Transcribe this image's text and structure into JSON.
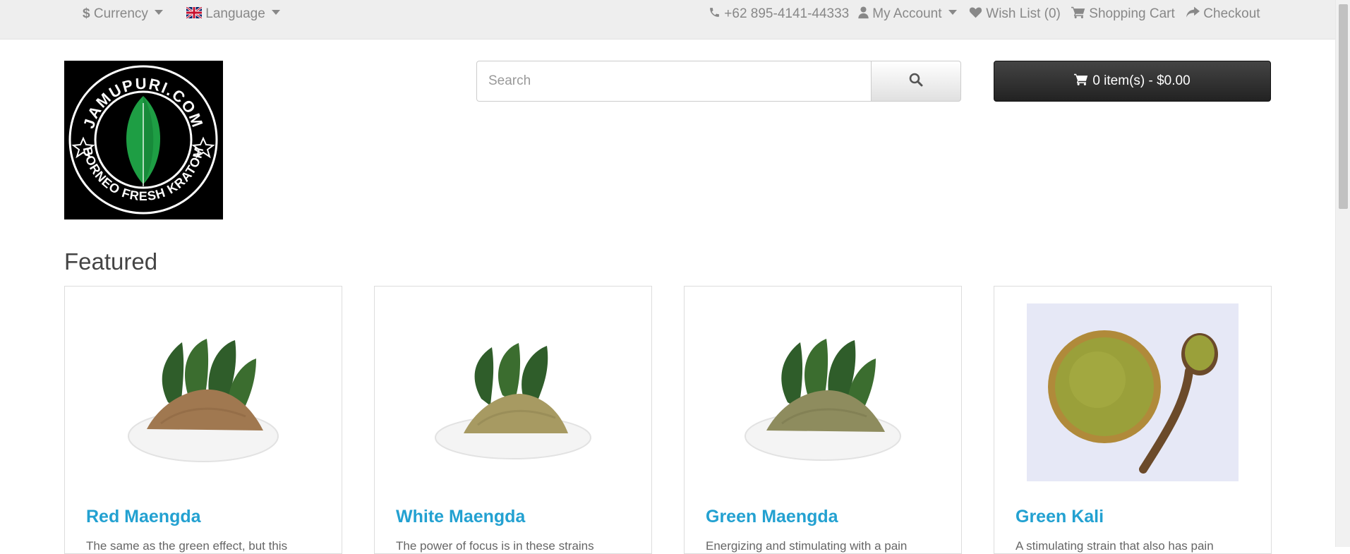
{
  "topbar": {
    "currency": {
      "label": "Currency",
      "icon": "dollar-icon"
    },
    "language": {
      "label": "Language",
      "icon": "flag-icon"
    },
    "phone": {
      "label": "+62 895-4141-44333",
      "icon": "phone-icon"
    },
    "account": {
      "label": "My Account",
      "icon": "user-icon"
    },
    "wishlist": {
      "label": "Wish List (0)",
      "icon": "heart-icon"
    },
    "cart": {
      "label": "Shopping Cart",
      "icon": "cart-icon"
    },
    "checkout": {
      "label": "Checkout",
      "icon": "share-icon"
    }
  },
  "logo": {
    "text_top": "JAMUPURI.COM",
    "text_bottom": "BORNEO FRESH KRATOM"
  },
  "search": {
    "placeholder": "Search",
    "icon": "search-icon"
  },
  "cart_button": {
    "label": "0 item(s) - $0.00",
    "icon": "cart-icon"
  },
  "featured": {
    "title": "Featured",
    "products": [
      {
        "name": "Red Maengda",
        "desc": "The same as the green effect, but this",
        "powder_color": "#a07850"
      },
      {
        "name": "White Maengda",
        "desc": "The power of focus is in these strains",
        "powder_color": "#a79a62"
      },
      {
        "name": "Green Maengda",
        "desc": "Energizing and stimulating with a pain",
        "powder_color": "#8e8c5e"
      },
      {
        "name": "Green Kali",
        "desc": "A stimulating strain that also has pain",
        "powder_color": "#9aa03a"
      }
    ]
  },
  "colors": {
    "link": "#23a1d1",
    "topbar_bg": "#eeeeee",
    "cart_bg": "#222222"
  }
}
